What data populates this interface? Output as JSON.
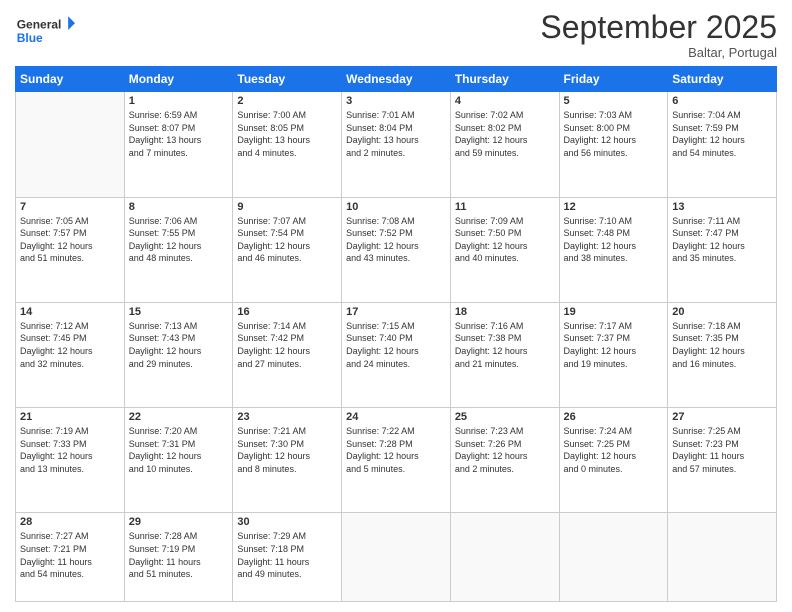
{
  "header": {
    "logo_line1": "General",
    "logo_line2": "Blue",
    "month": "September 2025",
    "location": "Baltar, Portugal"
  },
  "days_of_week": [
    "Sunday",
    "Monday",
    "Tuesday",
    "Wednesday",
    "Thursday",
    "Friday",
    "Saturday"
  ],
  "weeks": [
    [
      {
        "day": "",
        "info": ""
      },
      {
        "day": "1",
        "info": "Sunrise: 6:59 AM\nSunset: 8:07 PM\nDaylight: 13 hours\nand 7 minutes."
      },
      {
        "day": "2",
        "info": "Sunrise: 7:00 AM\nSunset: 8:05 PM\nDaylight: 13 hours\nand 4 minutes."
      },
      {
        "day": "3",
        "info": "Sunrise: 7:01 AM\nSunset: 8:04 PM\nDaylight: 13 hours\nand 2 minutes."
      },
      {
        "day": "4",
        "info": "Sunrise: 7:02 AM\nSunset: 8:02 PM\nDaylight: 12 hours\nand 59 minutes."
      },
      {
        "day": "5",
        "info": "Sunrise: 7:03 AM\nSunset: 8:00 PM\nDaylight: 12 hours\nand 56 minutes."
      },
      {
        "day": "6",
        "info": "Sunrise: 7:04 AM\nSunset: 7:59 PM\nDaylight: 12 hours\nand 54 minutes."
      }
    ],
    [
      {
        "day": "7",
        "info": "Sunrise: 7:05 AM\nSunset: 7:57 PM\nDaylight: 12 hours\nand 51 minutes."
      },
      {
        "day": "8",
        "info": "Sunrise: 7:06 AM\nSunset: 7:55 PM\nDaylight: 12 hours\nand 48 minutes."
      },
      {
        "day": "9",
        "info": "Sunrise: 7:07 AM\nSunset: 7:54 PM\nDaylight: 12 hours\nand 46 minutes."
      },
      {
        "day": "10",
        "info": "Sunrise: 7:08 AM\nSunset: 7:52 PM\nDaylight: 12 hours\nand 43 minutes."
      },
      {
        "day": "11",
        "info": "Sunrise: 7:09 AM\nSunset: 7:50 PM\nDaylight: 12 hours\nand 40 minutes."
      },
      {
        "day": "12",
        "info": "Sunrise: 7:10 AM\nSunset: 7:48 PM\nDaylight: 12 hours\nand 38 minutes."
      },
      {
        "day": "13",
        "info": "Sunrise: 7:11 AM\nSunset: 7:47 PM\nDaylight: 12 hours\nand 35 minutes."
      }
    ],
    [
      {
        "day": "14",
        "info": "Sunrise: 7:12 AM\nSunset: 7:45 PM\nDaylight: 12 hours\nand 32 minutes."
      },
      {
        "day": "15",
        "info": "Sunrise: 7:13 AM\nSunset: 7:43 PM\nDaylight: 12 hours\nand 29 minutes."
      },
      {
        "day": "16",
        "info": "Sunrise: 7:14 AM\nSunset: 7:42 PM\nDaylight: 12 hours\nand 27 minutes."
      },
      {
        "day": "17",
        "info": "Sunrise: 7:15 AM\nSunset: 7:40 PM\nDaylight: 12 hours\nand 24 minutes."
      },
      {
        "day": "18",
        "info": "Sunrise: 7:16 AM\nSunset: 7:38 PM\nDaylight: 12 hours\nand 21 minutes."
      },
      {
        "day": "19",
        "info": "Sunrise: 7:17 AM\nSunset: 7:37 PM\nDaylight: 12 hours\nand 19 minutes."
      },
      {
        "day": "20",
        "info": "Sunrise: 7:18 AM\nSunset: 7:35 PM\nDaylight: 12 hours\nand 16 minutes."
      }
    ],
    [
      {
        "day": "21",
        "info": "Sunrise: 7:19 AM\nSunset: 7:33 PM\nDaylight: 12 hours\nand 13 minutes."
      },
      {
        "day": "22",
        "info": "Sunrise: 7:20 AM\nSunset: 7:31 PM\nDaylight: 12 hours\nand 10 minutes."
      },
      {
        "day": "23",
        "info": "Sunrise: 7:21 AM\nSunset: 7:30 PM\nDaylight: 12 hours\nand 8 minutes."
      },
      {
        "day": "24",
        "info": "Sunrise: 7:22 AM\nSunset: 7:28 PM\nDaylight: 12 hours\nand 5 minutes."
      },
      {
        "day": "25",
        "info": "Sunrise: 7:23 AM\nSunset: 7:26 PM\nDaylight: 12 hours\nand 2 minutes."
      },
      {
        "day": "26",
        "info": "Sunrise: 7:24 AM\nSunset: 7:25 PM\nDaylight: 12 hours\nand 0 minutes."
      },
      {
        "day": "27",
        "info": "Sunrise: 7:25 AM\nSunset: 7:23 PM\nDaylight: 11 hours\nand 57 minutes."
      }
    ],
    [
      {
        "day": "28",
        "info": "Sunrise: 7:27 AM\nSunset: 7:21 PM\nDaylight: 11 hours\nand 54 minutes."
      },
      {
        "day": "29",
        "info": "Sunrise: 7:28 AM\nSunset: 7:19 PM\nDaylight: 11 hours\nand 51 minutes."
      },
      {
        "day": "30",
        "info": "Sunrise: 7:29 AM\nSunset: 7:18 PM\nDaylight: 11 hours\nand 49 minutes."
      },
      {
        "day": "",
        "info": ""
      },
      {
        "day": "",
        "info": ""
      },
      {
        "day": "",
        "info": ""
      },
      {
        "day": "",
        "info": ""
      }
    ]
  ]
}
